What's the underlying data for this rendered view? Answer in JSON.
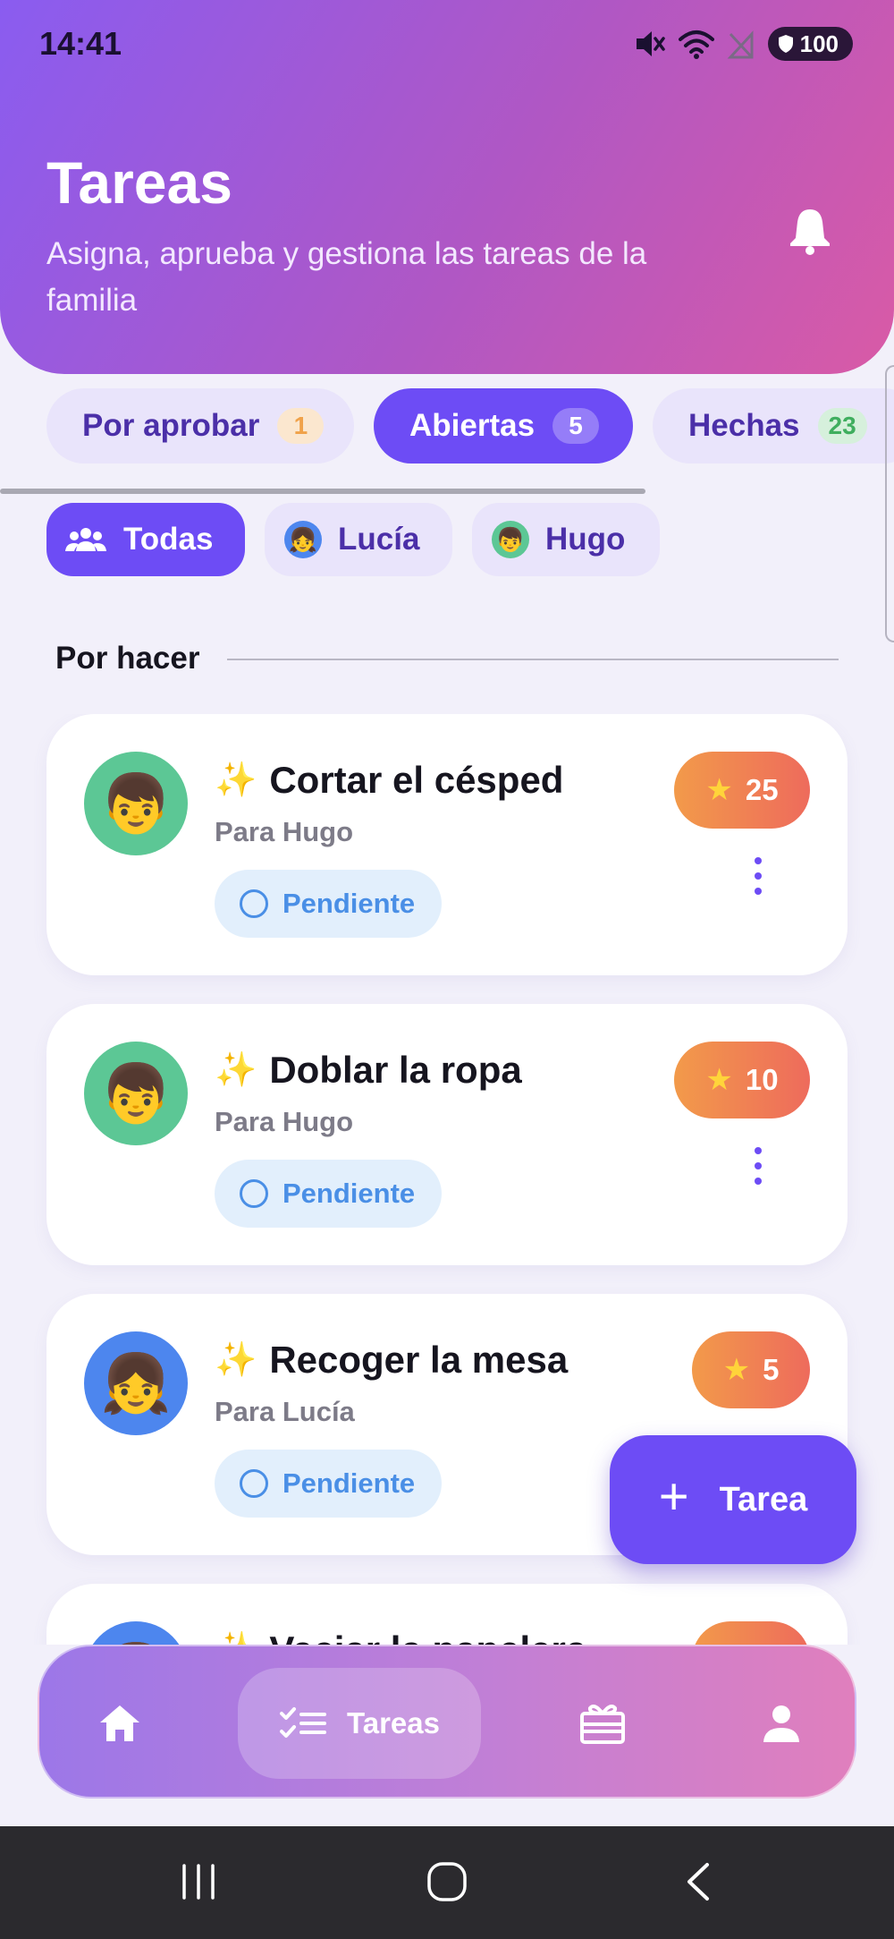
{
  "status_bar": {
    "time": "14:41",
    "battery": "100"
  },
  "header": {
    "title": "Tareas",
    "subtitle": "Asigna, aprueba y gestiona las tareas de la familia"
  },
  "tabs": [
    {
      "label": "Por aprobar",
      "count": "1",
      "active": false,
      "count_color": "#f0a24a",
      "count_bg": "#fbe7cf"
    },
    {
      "label": "Abiertas",
      "count": "5",
      "active": true
    },
    {
      "label": "Hechas",
      "count": "23",
      "active": false,
      "count_color": "#3fae5e",
      "count_bg": "#d6f0dc"
    }
  ],
  "filters": [
    {
      "label": "Todas",
      "icon": "group-icon",
      "active": true
    },
    {
      "label": "Lucía",
      "icon": "👧",
      "active": false
    },
    {
      "label": "Hugo",
      "icon": "👦",
      "active": false
    }
  ],
  "section": {
    "title": "Por hacer"
  },
  "tasks": [
    {
      "title": "Cortar el césped",
      "for": "Para Hugo",
      "status": "Pendiente",
      "points": "25",
      "avatar": "👦",
      "avatar_color": "#5cc795"
    },
    {
      "title": "Doblar la ropa",
      "for": "Para Hugo",
      "status": "Pendiente",
      "points": "10",
      "avatar": "👦",
      "avatar_color": "#5cc795"
    },
    {
      "title": "Recoger la mesa",
      "for": "Para Lucía",
      "status": "Pendiente",
      "points": "5",
      "avatar": "👧",
      "avatar_color": "#4d86ee"
    },
    {
      "title": "Vaciar la papelera",
      "for": "",
      "status": "",
      "points": "",
      "avatar": "👧",
      "avatar_color": "#4d86ee"
    }
  ],
  "fab": {
    "label": "Tarea"
  },
  "bottom_nav": {
    "active_label": "Tareas"
  },
  "colors": {
    "accent": "#6d4cf5",
    "pending": "#4a8fe6"
  }
}
